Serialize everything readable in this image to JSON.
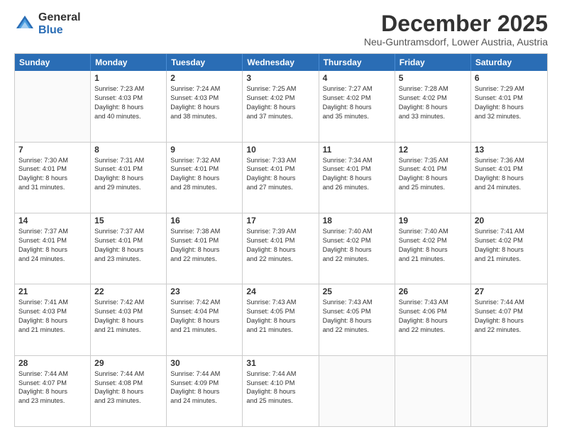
{
  "logo": {
    "general": "General",
    "blue": "Blue"
  },
  "header": {
    "month": "December 2025",
    "location": "Neu-Guntramsdorf, Lower Austria, Austria"
  },
  "weekdays": [
    "Sunday",
    "Monday",
    "Tuesday",
    "Wednesday",
    "Thursday",
    "Friday",
    "Saturday"
  ],
  "weeks": [
    [
      {
        "day": "",
        "info": ""
      },
      {
        "day": "1",
        "info": "Sunrise: 7:23 AM\nSunset: 4:03 PM\nDaylight: 8 hours\nand 40 minutes."
      },
      {
        "day": "2",
        "info": "Sunrise: 7:24 AM\nSunset: 4:03 PM\nDaylight: 8 hours\nand 38 minutes."
      },
      {
        "day": "3",
        "info": "Sunrise: 7:25 AM\nSunset: 4:02 PM\nDaylight: 8 hours\nand 37 minutes."
      },
      {
        "day": "4",
        "info": "Sunrise: 7:27 AM\nSunset: 4:02 PM\nDaylight: 8 hours\nand 35 minutes."
      },
      {
        "day": "5",
        "info": "Sunrise: 7:28 AM\nSunset: 4:02 PM\nDaylight: 8 hours\nand 33 minutes."
      },
      {
        "day": "6",
        "info": "Sunrise: 7:29 AM\nSunset: 4:01 PM\nDaylight: 8 hours\nand 32 minutes."
      }
    ],
    [
      {
        "day": "7",
        "info": "Sunrise: 7:30 AM\nSunset: 4:01 PM\nDaylight: 8 hours\nand 31 minutes."
      },
      {
        "day": "8",
        "info": "Sunrise: 7:31 AM\nSunset: 4:01 PM\nDaylight: 8 hours\nand 29 minutes."
      },
      {
        "day": "9",
        "info": "Sunrise: 7:32 AM\nSunset: 4:01 PM\nDaylight: 8 hours\nand 28 minutes."
      },
      {
        "day": "10",
        "info": "Sunrise: 7:33 AM\nSunset: 4:01 PM\nDaylight: 8 hours\nand 27 minutes."
      },
      {
        "day": "11",
        "info": "Sunrise: 7:34 AM\nSunset: 4:01 PM\nDaylight: 8 hours\nand 26 minutes."
      },
      {
        "day": "12",
        "info": "Sunrise: 7:35 AM\nSunset: 4:01 PM\nDaylight: 8 hours\nand 25 minutes."
      },
      {
        "day": "13",
        "info": "Sunrise: 7:36 AM\nSunset: 4:01 PM\nDaylight: 8 hours\nand 24 minutes."
      }
    ],
    [
      {
        "day": "14",
        "info": "Sunrise: 7:37 AM\nSunset: 4:01 PM\nDaylight: 8 hours\nand 24 minutes."
      },
      {
        "day": "15",
        "info": "Sunrise: 7:37 AM\nSunset: 4:01 PM\nDaylight: 8 hours\nand 23 minutes."
      },
      {
        "day": "16",
        "info": "Sunrise: 7:38 AM\nSunset: 4:01 PM\nDaylight: 8 hours\nand 22 minutes."
      },
      {
        "day": "17",
        "info": "Sunrise: 7:39 AM\nSunset: 4:01 PM\nDaylight: 8 hours\nand 22 minutes."
      },
      {
        "day": "18",
        "info": "Sunrise: 7:40 AM\nSunset: 4:02 PM\nDaylight: 8 hours\nand 22 minutes."
      },
      {
        "day": "19",
        "info": "Sunrise: 7:40 AM\nSunset: 4:02 PM\nDaylight: 8 hours\nand 21 minutes."
      },
      {
        "day": "20",
        "info": "Sunrise: 7:41 AM\nSunset: 4:02 PM\nDaylight: 8 hours\nand 21 minutes."
      }
    ],
    [
      {
        "day": "21",
        "info": "Sunrise: 7:41 AM\nSunset: 4:03 PM\nDaylight: 8 hours\nand 21 minutes."
      },
      {
        "day": "22",
        "info": "Sunrise: 7:42 AM\nSunset: 4:03 PM\nDaylight: 8 hours\nand 21 minutes."
      },
      {
        "day": "23",
        "info": "Sunrise: 7:42 AM\nSunset: 4:04 PM\nDaylight: 8 hours\nand 21 minutes."
      },
      {
        "day": "24",
        "info": "Sunrise: 7:43 AM\nSunset: 4:05 PM\nDaylight: 8 hours\nand 21 minutes."
      },
      {
        "day": "25",
        "info": "Sunrise: 7:43 AM\nSunset: 4:05 PM\nDaylight: 8 hours\nand 22 minutes."
      },
      {
        "day": "26",
        "info": "Sunrise: 7:43 AM\nSunset: 4:06 PM\nDaylight: 8 hours\nand 22 minutes."
      },
      {
        "day": "27",
        "info": "Sunrise: 7:44 AM\nSunset: 4:07 PM\nDaylight: 8 hours\nand 22 minutes."
      }
    ],
    [
      {
        "day": "28",
        "info": "Sunrise: 7:44 AM\nSunset: 4:07 PM\nDaylight: 8 hours\nand 23 minutes."
      },
      {
        "day": "29",
        "info": "Sunrise: 7:44 AM\nSunset: 4:08 PM\nDaylight: 8 hours\nand 23 minutes."
      },
      {
        "day": "30",
        "info": "Sunrise: 7:44 AM\nSunset: 4:09 PM\nDaylight: 8 hours\nand 24 minutes."
      },
      {
        "day": "31",
        "info": "Sunrise: 7:44 AM\nSunset: 4:10 PM\nDaylight: 8 hours\nand 25 minutes."
      },
      {
        "day": "",
        "info": ""
      },
      {
        "day": "",
        "info": ""
      },
      {
        "day": "",
        "info": ""
      }
    ]
  ]
}
